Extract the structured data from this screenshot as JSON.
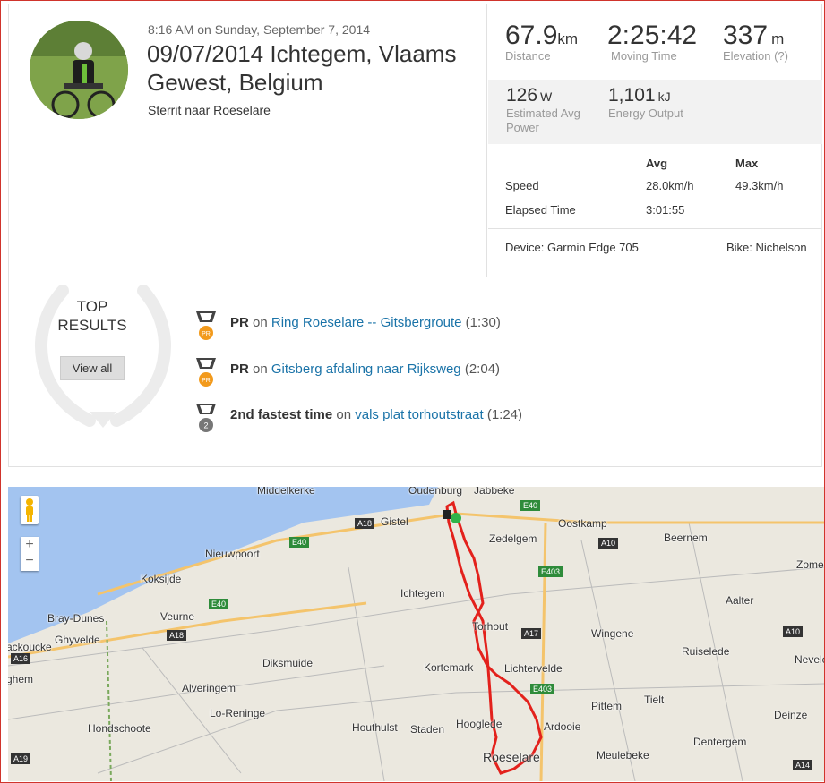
{
  "activity": {
    "dateline": "8:16 AM on Sunday, September 7, 2014",
    "title": "09/07/2014 Ichtegem, Vlaams Gewest, Belgium",
    "description": "Sterrit naar Roeselare"
  },
  "stats": {
    "distance": {
      "value": "67.9",
      "unit": "km",
      "label": "Distance"
    },
    "moving_time": {
      "value": "2:25:42",
      "label": "Moving Time"
    },
    "elevation": {
      "value": "337",
      "unit": "m",
      "label": "Elevation (?)"
    },
    "power": {
      "value": "126",
      "unit": "W",
      "label": "Estimated Avg Power"
    },
    "energy": {
      "value": "1,101",
      "unit": "kJ",
      "label": "Energy Output"
    },
    "table": {
      "col_avg": "Avg",
      "col_max": "Max",
      "speed_label": "Speed",
      "speed_avg": "28.0km/h",
      "speed_max": "49.3km/h",
      "elapsed_label": "Elapsed Time",
      "elapsed_avg": "3:01:55"
    },
    "device": "Device: Garmin Edge 705",
    "bike": "Bike: Nichelson"
  },
  "top_results": {
    "heading_1": "TOP",
    "heading_2": "RESULTS",
    "view_all": "View all",
    "items": [
      {
        "badge": "PR",
        "medal_label": "PR",
        "on": "on",
        "segment": "Ring Roeselare -- Gitsbergroute",
        "time": "(1:30)"
      },
      {
        "badge": "PR",
        "medal_label": "PR",
        "on": "on",
        "segment": "Gitsberg afdaling naar Rijksweg",
        "time": "(2:04)"
      },
      {
        "badge": "2nd fastest time",
        "medal_label": "2",
        "on": "on",
        "segment": "vals plat torhoutstraat",
        "time": "(1:24)"
      }
    ]
  },
  "map": {
    "zoom_in": "+",
    "zoom_out": "−",
    "labels": [
      "Middelkerke",
      "Oudenburg",
      "Jabbeke",
      "Gistel",
      "Oostkamp",
      "Zedelgem",
      "Beernem",
      "Nieuwpoort",
      "Koksijde",
      "Ichtegem",
      "Aalter",
      "Bray-Dunes",
      "Veurne",
      "Torhout",
      "Wingene",
      "Ghyvelde",
      "Lichtervelde",
      "Ruiselede",
      "Diksmuide",
      "Kortemark",
      "Alveringem",
      "Tielt",
      "Lo-Reninge",
      "Pittem",
      "Deinze",
      "Hondschoote",
      "Houthulst",
      "Staden",
      "Hooglede",
      "Ardooie",
      "Dentergem",
      "Roeselare",
      "Meulebeke",
      "Zomergem",
      "Nevele",
      "ghem",
      "ackoucke"
    ],
    "shields": [
      "A18",
      "E40",
      "E40",
      "A10",
      "E403",
      "E40",
      "A18",
      "A17",
      "A10",
      "A16",
      "E403",
      "A14",
      "A19"
    ],
    "route_color": "#e3211c"
  }
}
